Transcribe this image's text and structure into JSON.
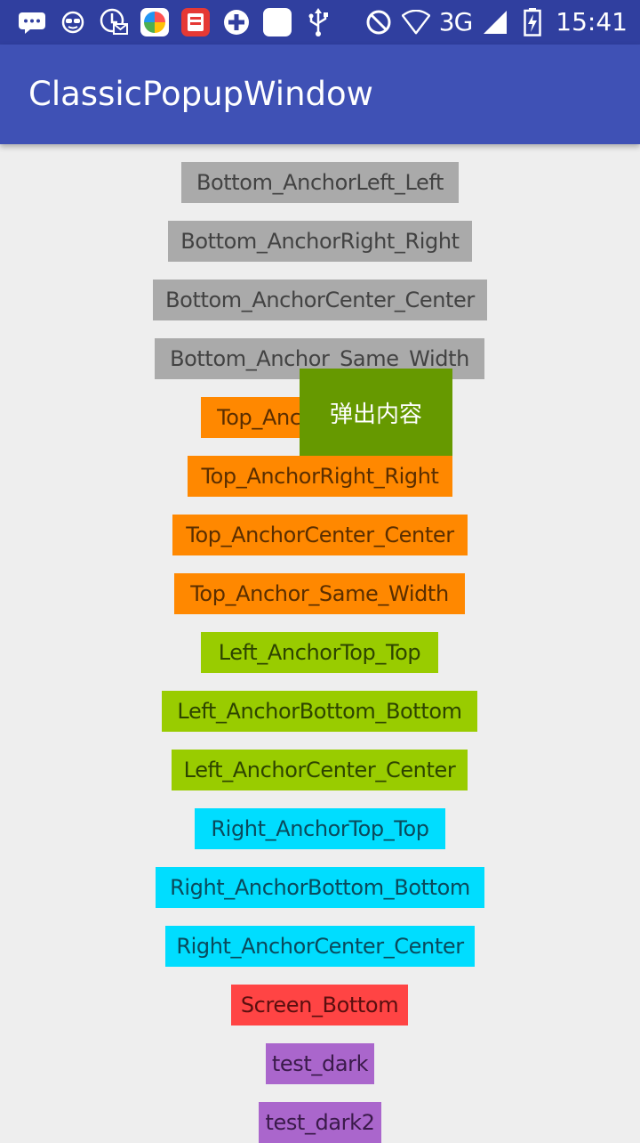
{
  "status_bar": {
    "network": "3G",
    "time": "15:41",
    "left_icons": [
      "chat-bubble-icon",
      "glasses-face-icon",
      "mail-sync-icon",
      "pinwheel-app-icon",
      "red-app-icon",
      "plus-circle-icon",
      "blank-square-icon",
      "usb-icon"
    ],
    "right_icons": [
      "do-not-disturb-icon",
      "wifi-icon",
      "signal-icon",
      "battery-charging-icon"
    ]
  },
  "app_bar": {
    "title": "ClassicPopupWindow"
  },
  "buttons": [
    {
      "label": "Bottom_AnchorLeft_Left",
      "color": "#aaaaaa"
    },
    {
      "label": "Bottom_AnchorRight_Right",
      "color": "#aaaaaa"
    },
    {
      "label": "Bottom_AnchorCenter_Center",
      "color": "#aaaaaa"
    },
    {
      "label": "Bottom_Anchor_Same_Width",
      "color": "#aaaaaa"
    },
    {
      "label": "Top_AnchorLeft_Left",
      "color": "#ff8800"
    },
    {
      "label": "Top_AnchorRight_Right",
      "color": "#ff8800"
    },
    {
      "label": "Top_AnchorCenter_Center",
      "color": "#ff8800"
    },
    {
      "label": "Top_Anchor_Same_Width",
      "color": "#ff8800"
    },
    {
      "label": "Left_AnchorTop_Top",
      "color": "#99cc00"
    },
    {
      "label": "Left_AnchorBottom_Bottom",
      "color": "#99cc00"
    },
    {
      "label": "Left_AnchorCenter_Center",
      "color": "#99cc00"
    },
    {
      "label": "Right_AnchorTop_Top",
      "color": "#00ddff"
    },
    {
      "label": "Right_AnchorBottom_Bottom",
      "color": "#00ddff"
    },
    {
      "label": "Right_AnchorCenter_Center",
      "color": "#00ddff"
    },
    {
      "label": "Screen_Bottom",
      "color": "#ff4444"
    },
    {
      "label": "test_dark",
      "color": "#aa66cc"
    },
    {
      "label": "test_dark2",
      "color": "#aa66cc"
    }
  ],
  "popup": {
    "text": "弹出内容",
    "color": "#669900"
  },
  "colors": {
    "status_bar": "#303f9f",
    "app_bar": "#3f51b5",
    "background": "#eeeeee"
  }
}
